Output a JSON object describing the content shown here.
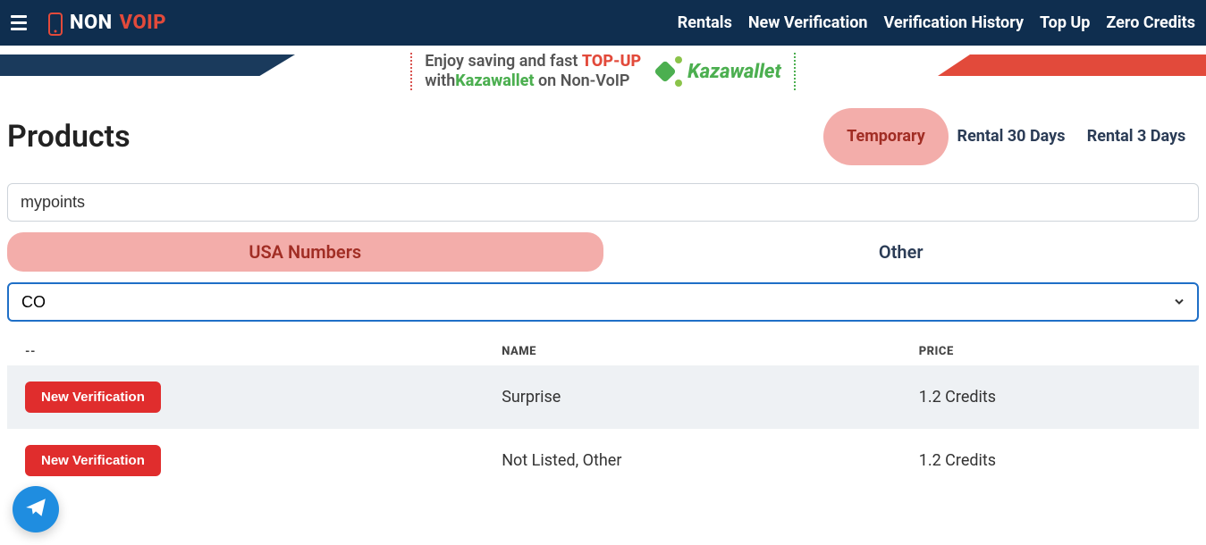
{
  "brand": {
    "non": "NON",
    "voip": "VOIP"
  },
  "nav": {
    "rentals": "Rentals",
    "new_verification": "New Verification",
    "verification_history": "Verification History",
    "top_up": "Top Up",
    "zero_credits": "Zero Credits"
  },
  "banner": {
    "line1_prefix": "Enjoy saving and fast ",
    "line1_strong": "TOP-UP",
    "line2_prefix": "with",
    "line2_brand": "Kazawallet",
    "line2_suffix": " on Non-VoIP",
    "logo_text": "Kazawallet"
  },
  "page_title": "Products",
  "duration_tabs": {
    "temporary": "Temporary",
    "rental30": "Rental 30 Days",
    "rental3": "Rental 3 Days"
  },
  "search_value": "mypoints",
  "region_tabs": {
    "usa": "USA Numbers",
    "other": "Other"
  },
  "state_value": "CO",
  "table": {
    "headers": {
      "action": "--",
      "name": "NAME",
      "price": "PRICE"
    },
    "rows": [
      {
        "button": "New Verification",
        "name": "Surprise",
        "price": "1.2 Credits"
      },
      {
        "button": "New Verification",
        "name": "Not Listed, Other",
        "price": "1.2 Credits"
      }
    ]
  }
}
